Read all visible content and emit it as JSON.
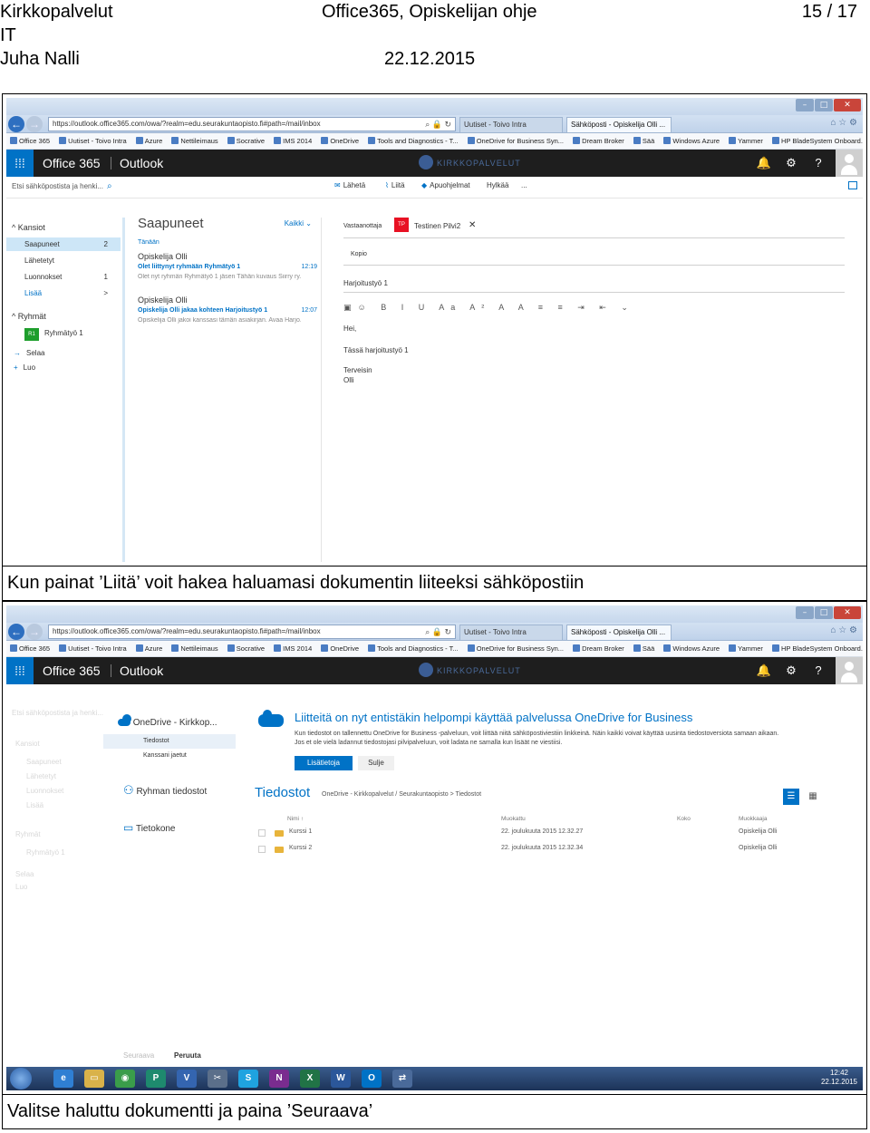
{
  "header": {
    "org": "Kirkkopalvelut",
    "unit": "IT",
    "author": "Juha Nalli",
    "title": "Office365, Opiskelijan ohje",
    "date": "22.12.2015",
    "page": "15 / 17"
  },
  "browser": {
    "url": "https://outlook.office365.com/owa/?realm=edu.seurakuntaopisto.fi#path=/mail/inbox",
    "url_host": "outlook.office365.com",
    "tabs": [
      "Uutiset - Toivo Intra",
      "Sähköposti - Opiskelija Olli ..."
    ],
    "favorites": [
      "Office 365",
      "Uutiset - Toivo Intra",
      "Azure",
      "Nettileimaus",
      "Socrative",
      "IMS 2014",
      "OneDrive",
      "Tools and Diagnostics - T...",
      "OneDrive for Business Syn...",
      "Dream Broker",
      "Sää",
      "Windows Azure",
      "Yammer",
      "HP BladeSystem Onboard..."
    ]
  },
  "suite": {
    "title": "Office 365",
    "app": "Outlook",
    "logo_text": "KIRKKOPALVELUT"
  },
  "shot1": {
    "search_placeholder": "Etsi sähköpostista ja henki...",
    "commands": [
      "Lähetä",
      "Liitä",
      "Apuohjelmat",
      "Hylkää",
      "..."
    ],
    "folders_header": "Kansiot",
    "folders": [
      {
        "name": "Saapuneet",
        "count": "2"
      },
      {
        "name": "Lähetetyt",
        "count": ""
      },
      {
        "name": "Luonnokset",
        "count": "1"
      },
      {
        "name": "Lisää",
        "count": ""
      }
    ],
    "groups_header": "Ryhmät",
    "group_badge": "R1",
    "group_name": "Ryhmätyö 1",
    "browse": "Selaa",
    "create": "Luo",
    "list_title": "Saapuneet",
    "list_filter": "Kaikki",
    "list_section": "Tänään",
    "messages": [
      {
        "sender": "Opiskelija Olli",
        "subject": "Olet liittynyt ryhmään Ryhmätyö 1",
        "preview": "Olet nyt ryhmän Ryhmätyö 1 jäsen Tähän kuvaus Siirry ry...",
        "time": "12:19"
      },
      {
        "sender": "Opiskelija Olli",
        "subject": "Opiskelija Olli jakaa kohteen Harjoitustyö 1",
        "preview": "Opiskelija Olli jakoi kanssasi tämän asiakirjan. Avaa Harjo...",
        "time": "12:07"
      }
    ],
    "to_label": "Vastaanottaja",
    "recipient_badge": "TP",
    "recipient": "Testinen Pilvi2",
    "cc_label": "Kopio",
    "subject": "Harjoitustyö 1",
    "body": [
      "Hei,",
      "Tässä harjoitustyö 1",
      "Terveisin",
      "Olli"
    ]
  },
  "caption1": "Kun painat ’Liitä’ voit hakea haluamasi dokumentin liiteeksi sähköpostiin",
  "shot2": {
    "nav_onedrive": "OneDrive - Kirkkop...",
    "nav_files": "Tiedostot",
    "nav_shared": "Kanssani jaetut",
    "nav_group_files": "Ryhman tiedostot",
    "nav_computer": "Tietokone",
    "banner_title": "Liitteitä on nyt entistäkin helpompi käyttää palvelussa OneDrive for Business",
    "banner_text1": "Kun tiedostot on tallennettu OneDrive for Business -palveluun, voit liittää niitä sähköpostiviestiin linkkeinä. Näin kaikki voivat käyttää uusinta tiedostoversiota samaan aikaan.",
    "banner_text2": "Jos et ole vielä ladannut tiedostojasi pilvipalveluun, voit ladata ne samalla kun lisäät ne viestiisi.",
    "btn_more": "Lisätietoja",
    "btn_close": "Sulje",
    "files_title": "Tiedostot",
    "breadcrumb": "OneDrive - Kirkkopalvelut / Seurakuntaopisto  >  Tiedostot",
    "columns": [
      "Nimi",
      "Muokattu",
      "Koko",
      "Muokkaaja"
    ],
    "rows": [
      {
        "name": "Kurssi 1",
        "modified": "22. joulukuuta 2015 12.32.27",
        "size": "",
        "by": "Opiskelija Olli"
      },
      {
        "name": "Kurssi 2",
        "modified": "22. joulukuuta 2015 12.32.34",
        "size": "",
        "by": "Opiskelija Olli"
      }
    ],
    "btn_next": "Seuraava",
    "btn_cancel": "Peruuta",
    "taskbar_apps": [
      "IE",
      "Explorer",
      "Chrome",
      "Publisher",
      "Visio",
      "Tools",
      "Skype",
      "OneNote",
      "Excel",
      "Word",
      "Outlook",
      "Remote"
    ],
    "clock_time": "12:42",
    "clock_date": "22.12.2015"
  },
  "caption2": "Valitse haluttu dokumentti ja paina ’Seuraava’",
  "colors": {
    "o365_blue": "#0072c6",
    "suite_bar": "#1e1e1e",
    "selected_folder": "#cde6f7",
    "badge_red": "#e81123",
    "group_green": "#1e9e2c"
  }
}
